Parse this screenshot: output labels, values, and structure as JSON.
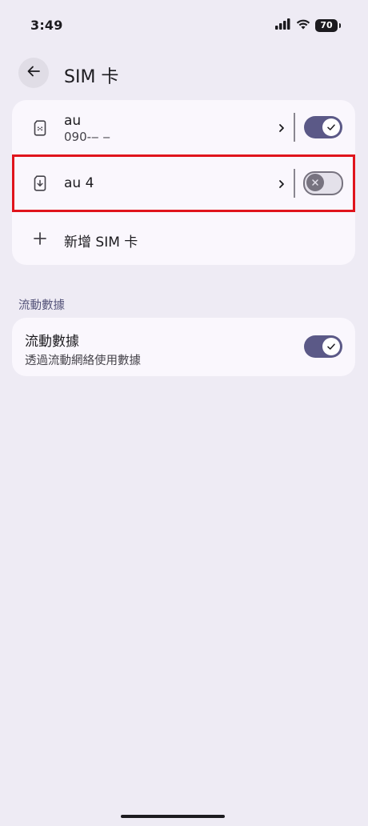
{
  "status_bar": {
    "time": "3:49",
    "battery": "70",
    "icons": [
      "signal-icon",
      "wifi-icon",
      "battery-icon"
    ]
  },
  "header": {
    "back_icon": "arrow-left-icon",
    "title": "SIM 卡"
  },
  "sims": [
    {
      "name": "au",
      "number": "090-‒ ‒",
      "enabled": true,
      "icon": "sim-card-icon"
    },
    {
      "name": "au 4",
      "number": "",
      "enabled": false,
      "icon": "esim-download-icon"
    }
  ],
  "add_sim": {
    "label": "新增 SIM 卡",
    "icon": "plus-icon"
  },
  "mobile_data_section": {
    "header": "流動數據",
    "title": "流動數據",
    "subtitle": "透過流動網絡使用數據",
    "enabled": true
  },
  "colors": {
    "background": "#EEEBF4",
    "card": "#FAF7FD",
    "toggle_on": "#5B5987",
    "highlight": "#E0141C"
  }
}
